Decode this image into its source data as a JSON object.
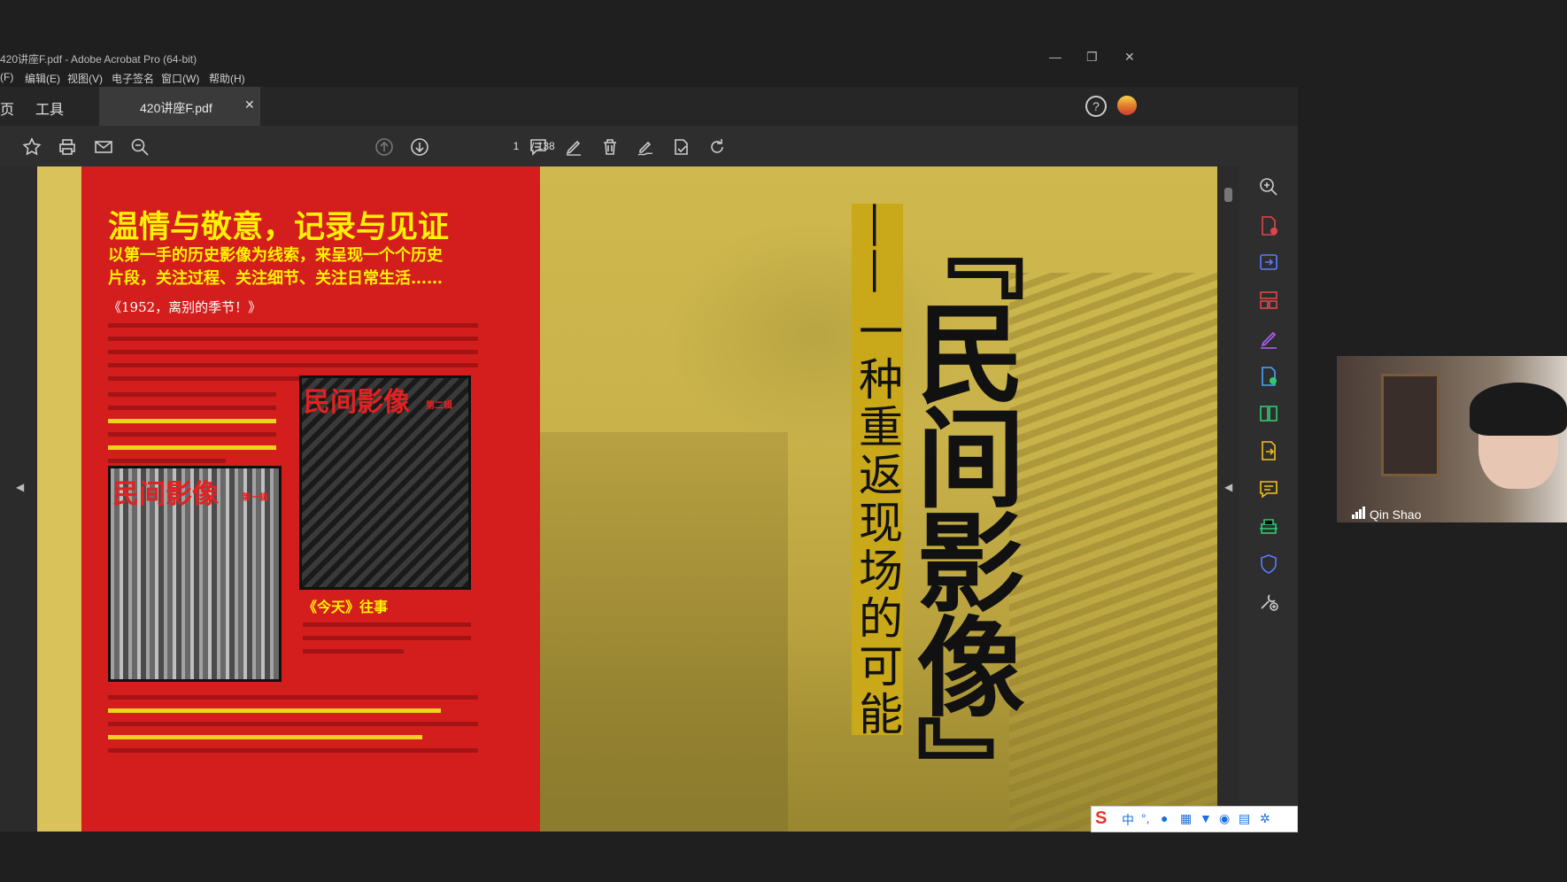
{
  "window": {
    "title": "420讲座F.pdf - Adobe Acrobat Pro (64-bit)"
  },
  "menu": [
    "(F)",
    "编辑(E)",
    "视图(V)",
    "电子签名",
    "窗口(W)",
    "帮助(H)"
  ],
  "tabs": {
    "home": "页",
    "tools": "工具",
    "document": "420讲座F.pdf"
  },
  "toolbar": {
    "current_page": "1",
    "total_pages": "/ 138"
  },
  "magazine": {
    "headline": "温情与敬意，记录与见证",
    "subhead_line1": "以第一手的历史影像为线索，来呈现一个个历史",
    "subhead_line2": "片段，关注过程、关注细节、关注日常生活……",
    "section1_title": "《1952，离别的季节！》",
    "cover1_title": "民间影像",
    "cover1_sub": "第一辑",
    "cover2_title": "民间影像",
    "cover2_sub": "第二辑",
    "caption2": "《今天》往事",
    "big_title": "『民间影像』",
    "vertical_subtitle": "一种重返现场的可能",
    "vertical_dash": "——"
  },
  "video": {
    "participant_name": "Qin Shao"
  },
  "ime": {
    "mode": "中"
  },
  "colors": {
    "accent_red": "#d41e1e",
    "headline_yellow": "#fff200",
    "page_yellow": "#d8c35a"
  }
}
